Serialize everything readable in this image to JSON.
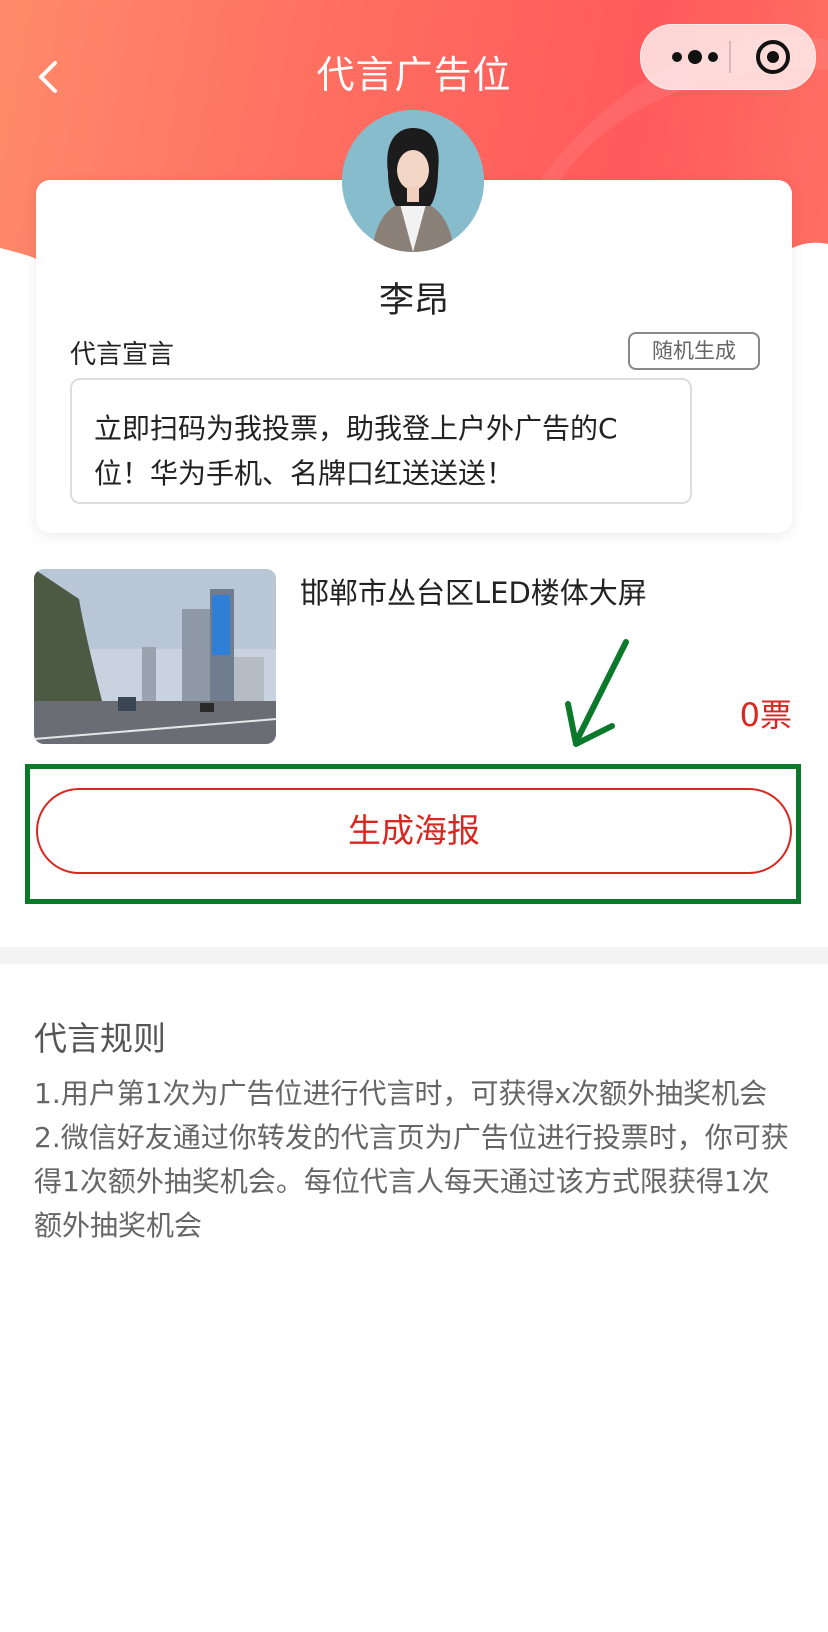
{
  "header": {
    "title": "代言广告位",
    "back_icon": "chevron-left-icon",
    "menu_icons": [
      "more-dots-icon",
      "target-icon"
    ]
  },
  "profile": {
    "name": "李昂",
    "slogan_label": "代言宣言",
    "random_button": "随机生成",
    "slogan_text": "立即扫码为我投票，助我登上户外广告的C位！华为手机、名牌口红送送送！"
  },
  "ad": {
    "title": "邯郸市丛台区LED楼体大屏",
    "votes": "0票"
  },
  "actions": {
    "generate_poster": "生成海报"
  },
  "rules": {
    "title": "代言规则",
    "items": [
      "1.用户第1次为广告位进行代言时，可获得x次额外抽奖机会",
      "2.微信好友通过你转发的代言页为广告位进行投票时，你可获得1次额外抽奖机会。每位代言人每天通过该方式限获得1次额外抽奖机会"
    ]
  },
  "colors": {
    "accent_red": "#d9271f",
    "header_gradient": "#ff6b5f",
    "annotation_green": "#0a7a2a"
  }
}
